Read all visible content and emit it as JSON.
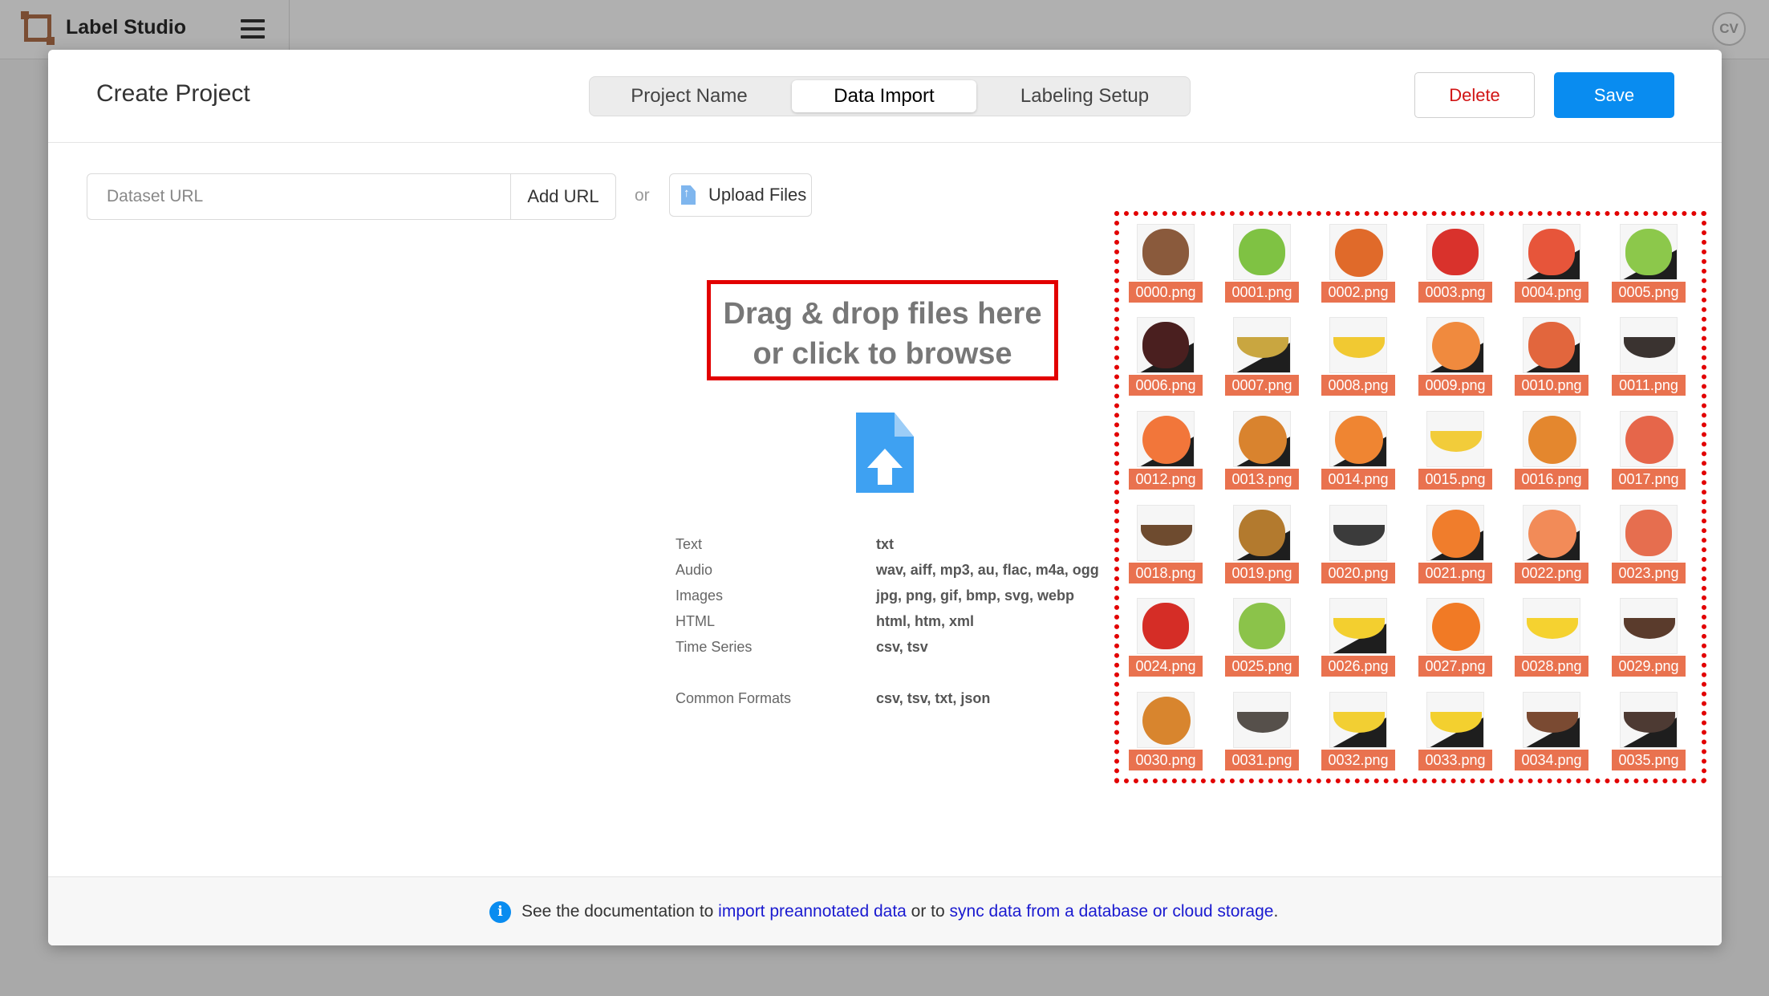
{
  "app": {
    "title": "Label Studio",
    "avatar_initials": "CV"
  },
  "modal": {
    "title": "Create Project",
    "tabs": [
      {
        "label": "Project Name",
        "active": false
      },
      {
        "label": "Data Import",
        "active": true
      },
      {
        "label": "Labeling Setup",
        "active": false
      }
    ],
    "delete_label": "Delete",
    "save_label": "Save"
  },
  "import": {
    "url_placeholder": "Dataset URL",
    "add_url_label": "Add URL",
    "or_text": "or",
    "upload_label": "Upload Files",
    "drop_line1": "Drag & drop files here",
    "drop_line2": "or click to browse",
    "formats": [
      {
        "label": "Text",
        "value": "txt"
      },
      {
        "label": "Audio",
        "value": "wav, aiff, mp3, au, flac, m4a, ogg"
      },
      {
        "label": "Images",
        "value": "jpg, png, gif, bmp, svg, webp"
      },
      {
        "label": "HTML",
        "value": "html, htm, xml"
      },
      {
        "label": "Time Series",
        "value": "csv, tsv"
      },
      {
        "label": "Common Formats",
        "value": "csv, tsv, txt, json"
      }
    ]
  },
  "thumbnails": [
    {
      "name": "0000.png",
      "fruit": "apple",
      "color": "#8a5a3c",
      "dark": false
    },
    {
      "name": "0001.png",
      "fruit": "apple",
      "color": "#7fc243",
      "dark": false
    },
    {
      "name": "0002.png",
      "fruit": "orange",
      "color": "#e06a2a",
      "dark": false
    },
    {
      "name": "0003.png",
      "fruit": "apple",
      "color": "#d9322c",
      "dark": false
    },
    {
      "name": "0004.png",
      "fruit": "apple",
      "color": "#e7553a",
      "dark": true
    },
    {
      "name": "0005.png",
      "fruit": "apple",
      "color": "#8cc84b",
      "dark": true
    },
    {
      "name": "0006.png",
      "fruit": "apple",
      "color": "#4a1f1f",
      "dark": true
    },
    {
      "name": "0007.png",
      "fruit": "banana",
      "color": "#c9a640",
      "dark": true
    },
    {
      "name": "0008.png",
      "fruit": "banana",
      "color": "#f1c932",
      "dark": false
    },
    {
      "name": "0009.png",
      "fruit": "orange",
      "color": "#f08a3e",
      "dark": true
    },
    {
      "name": "0010.png",
      "fruit": "apple",
      "color": "#e2663d",
      "dark": true
    },
    {
      "name": "0011.png",
      "fruit": "banana",
      "color": "#3a3330",
      "dark": false
    },
    {
      "name": "0012.png",
      "fruit": "orange",
      "color": "#f2763a",
      "dark": true
    },
    {
      "name": "0013.png",
      "fruit": "orange",
      "color": "#d9832e",
      "dark": true
    },
    {
      "name": "0014.png",
      "fruit": "orange",
      "color": "#ef8532",
      "dark": true
    },
    {
      "name": "0015.png",
      "fruit": "banana",
      "color": "#f2cc3a",
      "dark": false
    },
    {
      "name": "0016.png",
      "fruit": "orange",
      "color": "#e4872e",
      "dark": false
    },
    {
      "name": "0017.png",
      "fruit": "orange",
      "color": "#e6664a",
      "dark": false
    },
    {
      "name": "0018.png",
      "fruit": "banana",
      "color": "#6e4b2f",
      "dark": false
    },
    {
      "name": "0019.png",
      "fruit": "apple",
      "color": "#b37a2e",
      "dark": true
    },
    {
      "name": "0020.png",
      "fruit": "banana",
      "color": "#3b3b3b",
      "dark": false
    },
    {
      "name": "0021.png",
      "fruit": "orange",
      "color": "#f07d2c",
      "dark": true
    },
    {
      "name": "0022.png",
      "fruit": "orange",
      "color": "#f28b58",
      "dark": true
    },
    {
      "name": "0023.png",
      "fruit": "apple",
      "color": "#e66e4f",
      "dark": false
    },
    {
      "name": "0024.png",
      "fruit": "apple",
      "color": "#d52d26",
      "dark": false
    },
    {
      "name": "0025.png",
      "fruit": "apple",
      "color": "#8bc34a",
      "dark": false
    },
    {
      "name": "0026.png",
      "fruit": "banana",
      "color": "#f3cf2f",
      "dark": true
    },
    {
      "name": "0027.png",
      "fruit": "orange",
      "color": "#f17a25",
      "dark": false
    },
    {
      "name": "0028.png",
      "fruit": "banana",
      "color": "#f5d230",
      "dark": false
    },
    {
      "name": "0029.png",
      "fruit": "banana",
      "color": "#5a3b2c",
      "dark": false
    },
    {
      "name": "0030.png",
      "fruit": "orange",
      "color": "#d8852e",
      "dark": false
    },
    {
      "name": "0031.png",
      "fruit": "banana",
      "color": "#56504b",
      "dark": false
    },
    {
      "name": "0032.png",
      "fruit": "banana",
      "color": "#f2cf33",
      "dark": true
    },
    {
      "name": "0033.png",
      "fruit": "banana",
      "color": "#f3d02f",
      "dark": true
    },
    {
      "name": "0034.png",
      "fruit": "banana",
      "color": "#7a4a32",
      "dark": true
    },
    {
      "name": "0035.png",
      "fruit": "banana",
      "color": "#4d3a33",
      "dark": true
    }
  ],
  "footer": {
    "text_before": "See the documentation to ",
    "link1": "import preannotated data",
    "text_middle": " or to ",
    "link2": "sync data from a database or cloud storage",
    "text_after": "."
  },
  "colors": {
    "accent": "#098cf0",
    "danger": "#d11414",
    "highlight": "#e20000",
    "thumb_label": "#e9724f",
    "link": "#1a1ad0"
  }
}
